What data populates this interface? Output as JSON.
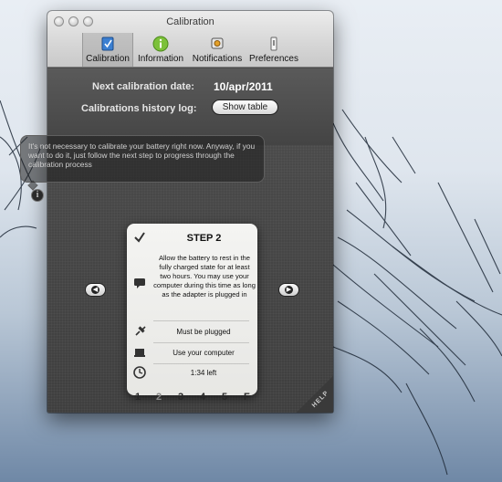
{
  "window": {
    "title": "Calibration"
  },
  "toolbar": {
    "items": [
      {
        "label": "Calibration",
        "icon": "calibration-icon",
        "selected": true
      },
      {
        "label": "Information",
        "icon": "info-icon"
      },
      {
        "label": "Notifications",
        "icon": "notifications-icon"
      },
      {
        "label": "Preferences",
        "icon": "preferences-icon"
      }
    ]
  },
  "info": {
    "next_label": "Next calibration date:",
    "next_value": "10/apr/2011",
    "history_label": "Calibrations history log:",
    "show_table": "Show table"
  },
  "message": "It's not necessary to calibrate your battery right now. Anyway, if you want to do it, just follow the next step to progress through the calibration process",
  "step": {
    "title": "STEP 2",
    "description": "Allow the battery to rest in the fully charged state for at least two hours. You may use your computer during this time as long as the adapter is plugged in",
    "requirements": [
      "Must be plugged",
      "Use your computer"
    ],
    "time_left": "1:34 left"
  },
  "steps": [
    "1",
    "2",
    "3",
    "4",
    "5",
    "F"
  ],
  "current_step": "2",
  "help_label": "HELP",
  "colors": {
    "accent_green": "#7cc13a",
    "accent_blue": "#3b7fd1",
    "panel": "#4a4a4a"
  }
}
